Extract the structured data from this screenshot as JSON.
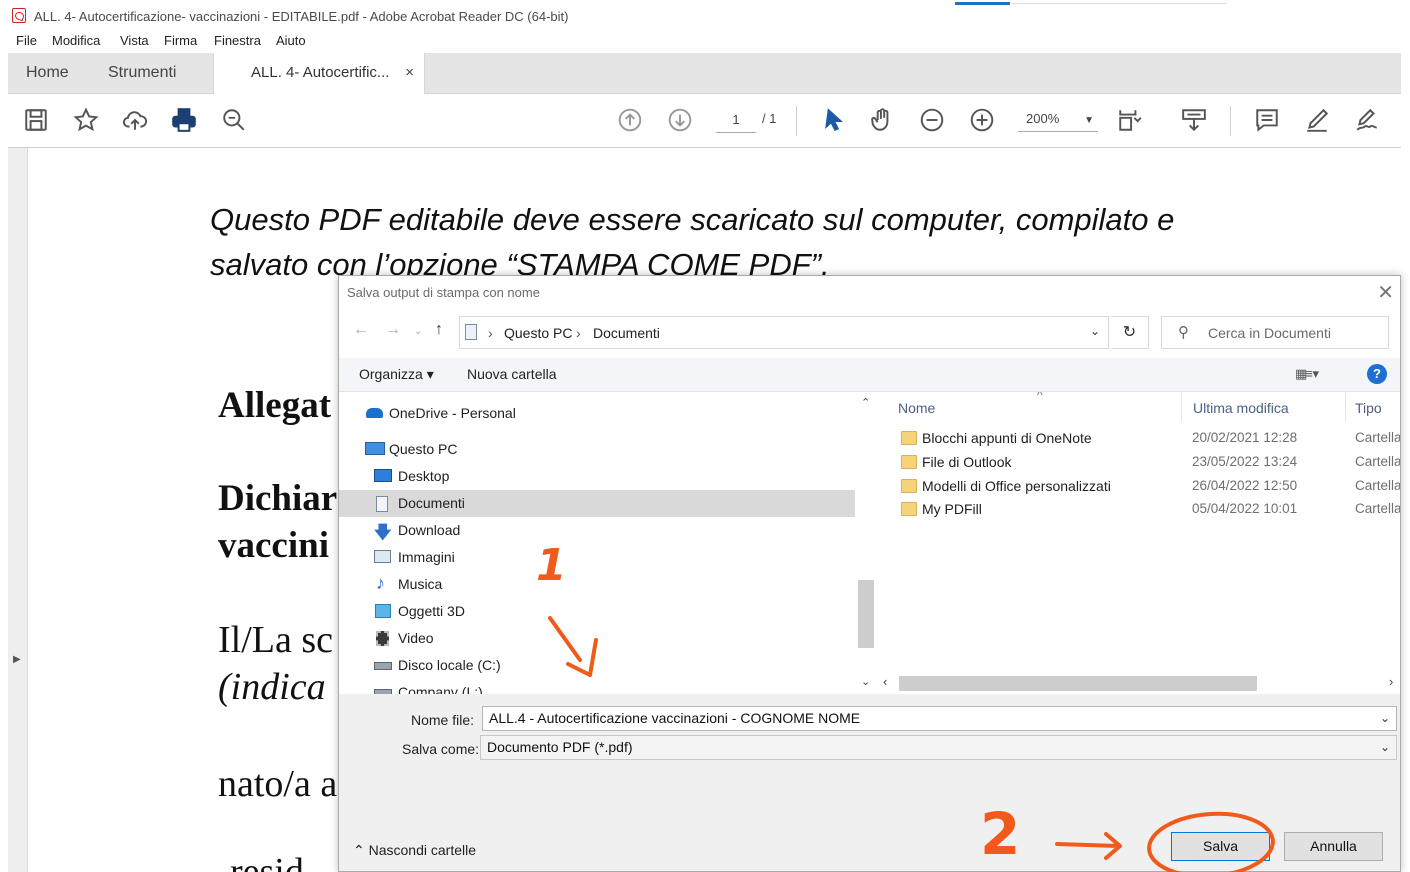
{
  "window": {
    "title": "ALL. 4- Autocertificazione- vaccinazioni - EDITABILE.pdf - Adobe Acrobat Reader DC (64-bit)"
  },
  "menu": [
    "File",
    "Modifica",
    "Vista",
    "Firma",
    "Finestra",
    "Aiuto"
  ],
  "tabs": {
    "home": "Home",
    "tools": "Strumenti",
    "document": "ALL. 4- Autocertific...",
    "close": "×"
  },
  "toolbar": {
    "icons": [
      "save-icon",
      "star-icon",
      "upload-cloud-icon",
      "print-icon",
      "zoom-search-icon",
      "page-up-icon",
      "page-down-icon",
      "select-arrow-icon",
      "hand-icon",
      "zoom-out-icon",
      "zoom-in-icon",
      "fit-page-icon",
      "scroll-mode-icon",
      "comment-icon",
      "highlight-pen-icon",
      "sign-icon"
    ],
    "page_current": "1",
    "page_total": "/ 1",
    "zoom": "200%"
  },
  "document": {
    "line1": "Questo PDF editabile deve essere scaricato sul computer, compilato e",
    "line2": "salvato con l’opzione “STAMPA COME PDF”.",
    "allegato": "Allegat",
    "dichiar": "Dichiar",
    "vaccini": "vaccini",
    "illa": "Il/La sc",
    "indica": "(indica",
    "nato": "nato/a a",
    "resid": "resid"
  },
  "dialog": {
    "title": "Salva output di stampa con nome",
    "close": "✕",
    "breadcrumb": [
      "Questo PC",
      "Documenti"
    ],
    "search_placeholder": "Cerca in Documenti",
    "organize": "Organizza ▾",
    "new_folder": "Nuova cartella",
    "help": "?",
    "nav_items": [
      {
        "label": "OneDrive - Personal",
        "icon": "onedrive-cloud-icon"
      },
      {
        "label": "Questo PC",
        "icon": "this-pc-icon"
      },
      {
        "label": "Desktop",
        "icon": "desktop-icon"
      },
      {
        "label": "Documenti",
        "icon": "documents-icon",
        "selected": true
      },
      {
        "label": "Download",
        "icon": "download-arrow-icon"
      },
      {
        "label": "Immagini",
        "icon": "pictures-icon"
      },
      {
        "label": "Musica",
        "icon": "music-note-icon"
      },
      {
        "label": "Oggetti 3D",
        "icon": "objects-3d-icon"
      },
      {
        "label": "Video",
        "icon": "video-film-icon"
      },
      {
        "label": "Disco locale (C:)",
        "icon": "local-disk-icon"
      },
      {
        "label": "Company (L:)",
        "icon": "network-drive-icon"
      }
    ],
    "columns": {
      "name": "Nome",
      "modified": "Ultima modifica",
      "type": "Tipo"
    },
    "files": [
      {
        "name": "Blocchi appunti di OneNote",
        "modified": "20/02/2021 12:28",
        "type": "Cartella"
      },
      {
        "name": "File di Outlook",
        "modified": "23/05/2022 13:24",
        "type": "Cartella"
      },
      {
        "name": "Modelli di Office personalizzati",
        "modified": "26/04/2022 12:50",
        "type": "Cartella"
      },
      {
        "name": "My PDFill",
        "modified": "05/04/2022 10:01",
        "type": "Cartella"
      }
    ],
    "filename_label": "Nome file:",
    "filename_value": "ALL.4 - Autocertificazione vaccinazioni - COGNOME NOME",
    "saveas_label": "Salva come:",
    "saveas_value": "Documento PDF (*.pdf)",
    "hide_folders": "Nascondi cartelle",
    "save_button": "Salva",
    "cancel_button": "Annulla"
  },
  "annotations": {
    "step1": "1",
    "step2": "2",
    "color": "#f05a1a"
  },
  "colors": {
    "accent": "#1d6fd1",
    "pdf_red": "#d0231f",
    "selection": "#d9d9d9"
  }
}
